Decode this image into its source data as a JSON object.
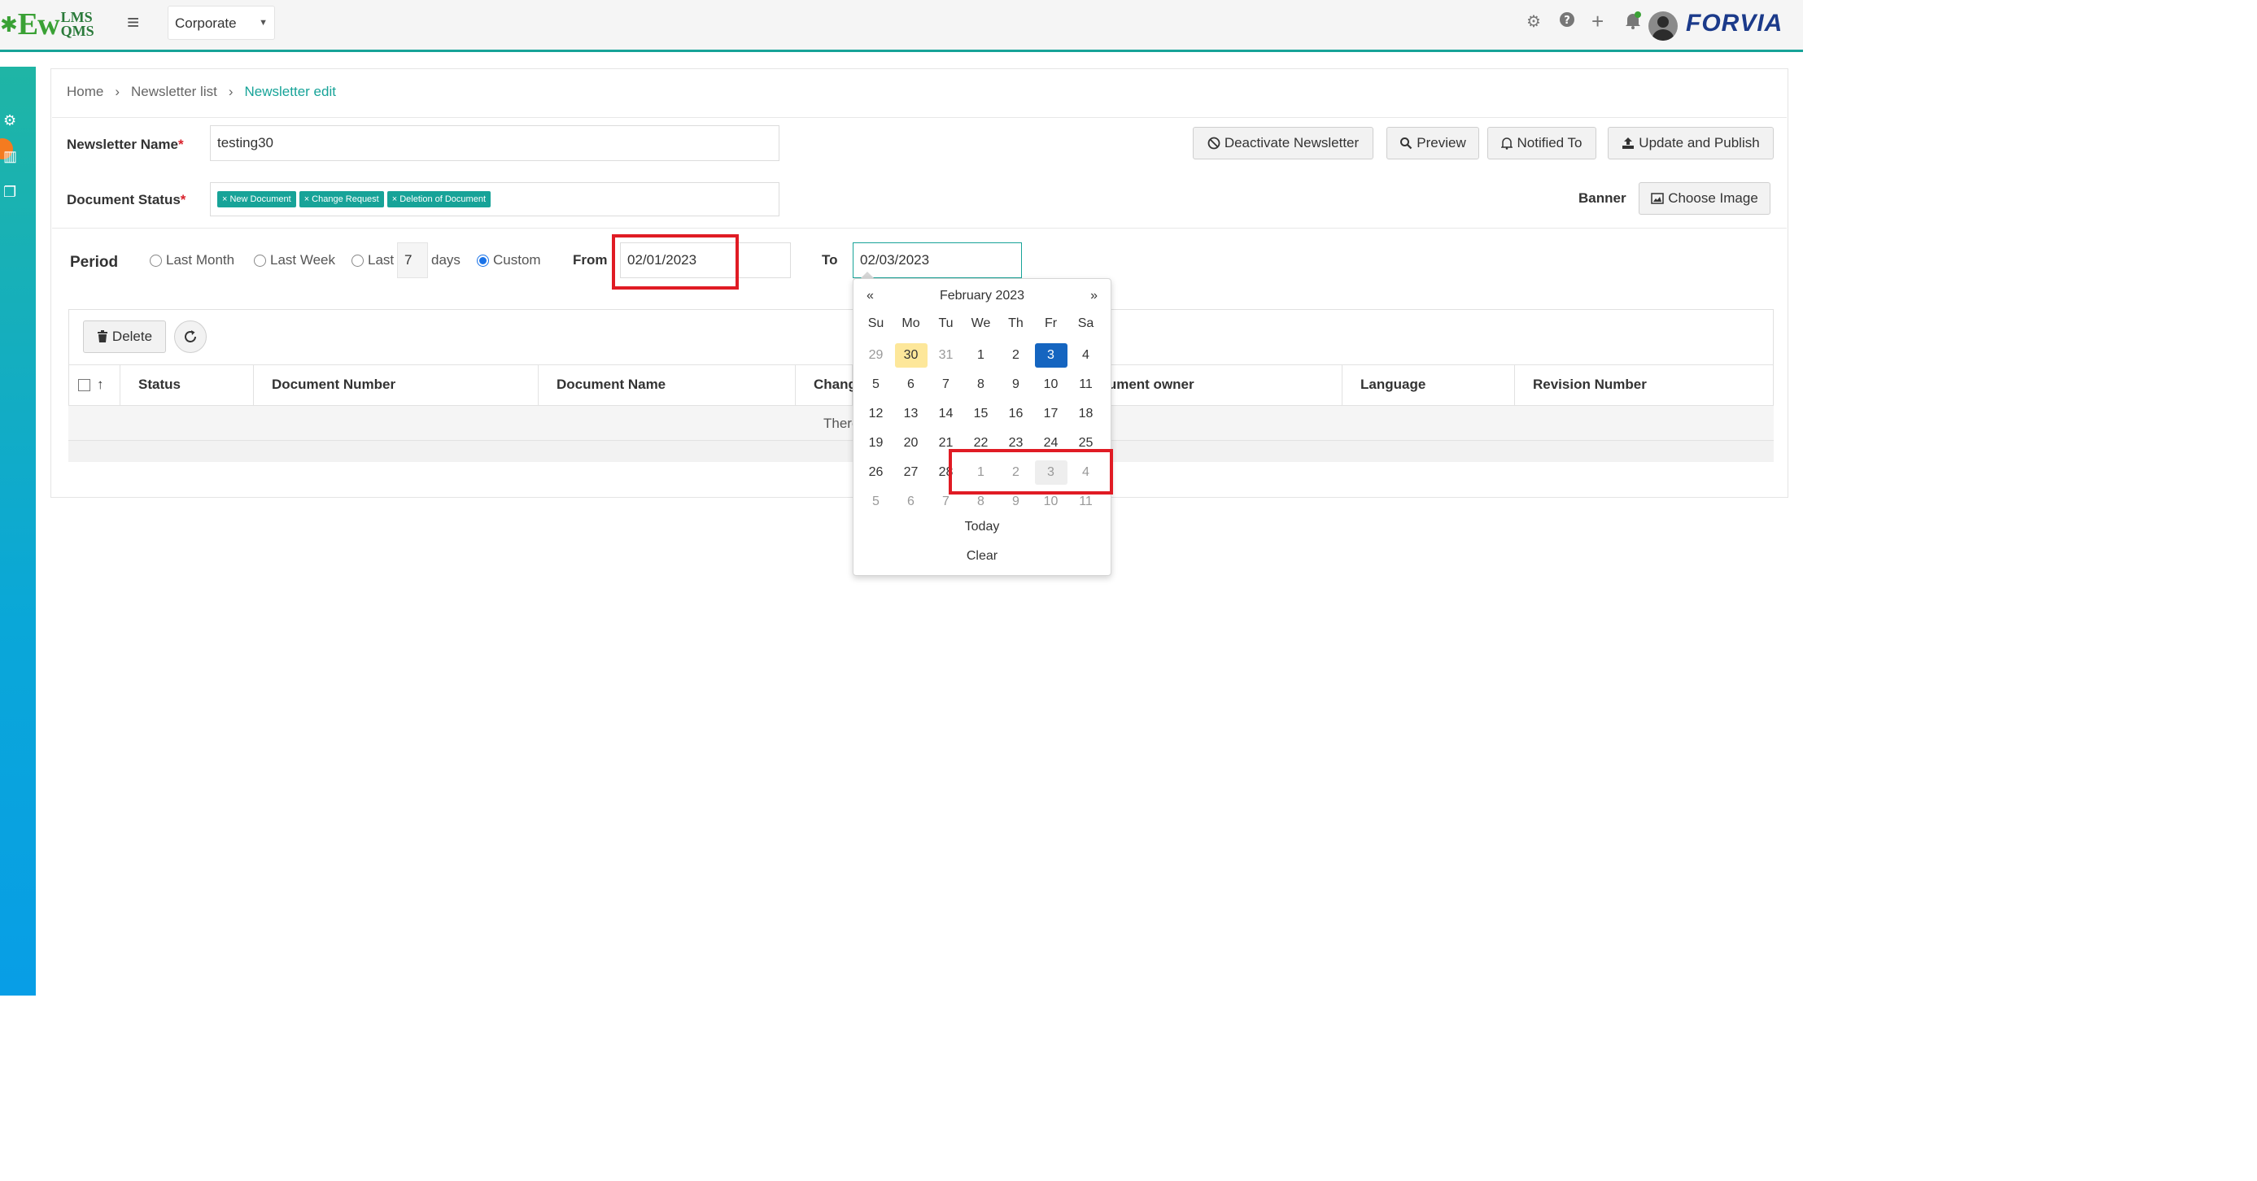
{
  "app": {
    "logo_main": "Ew",
    "logo_sub_top": "LMS",
    "logo_sub_bottom": "QMS",
    "brand": "FORVIA",
    "corporate_select": "Corporate"
  },
  "breadcrumb": {
    "home": "Home",
    "list": "Newsletter list",
    "edit": "Newsletter edit"
  },
  "form": {
    "newsletter_name_label": "Newsletter Name",
    "newsletter_name_value": "testing30",
    "document_status_label": "Document Status",
    "status_tags": [
      "New Document",
      "Change Request",
      "Deletion of Document"
    ],
    "banner_label": "Banner",
    "required_mark": "*"
  },
  "buttons": {
    "deactivate": "Deactivate Newsletter",
    "preview": "Preview",
    "notified_to": "Notified To",
    "update_publish": "Update and Publish",
    "choose_image": "Choose Image",
    "delete": "Delete"
  },
  "period": {
    "label": "Period",
    "last_month": "Last Month",
    "last_week": "Last Week",
    "last": "Last",
    "days_value": "7",
    "days": "days",
    "custom": "Custom",
    "from_label": "From",
    "from_value": "02/01/2023",
    "to_label": "To",
    "to_value": "02/03/2023"
  },
  "table": {
    "headers": [
      "Status",
      "Document Number",
      "Document Name",
      "Chang",
      "ocument owner",
      "Language",
      "Revision Number"
    ],
    "no_records_text": "There"
  },
  "datepicker": {
    "prev": "«",
    "next": "»",
    "month_title": "February 2023",
    "days_of_week": [
      "Su",
      "Mo",
      "Tu",
      "We",
      "Th",
      "Fr",
      "Sa"
    ],
    "weeks": [
      [
        "29",
        "30",
        "31",
        "1",
        "2",
        "3",
        "4"
      ],
      [
        "5",
        "6",
        "7",
        "8",
        "9",
        "10",
        "11"
      ],
      [
        "12",
        "13",
        "14",
        "15",
        "16",
        "17",
        "18"
      ],
      [
        "19",
        "20",
        "21",
        "22",
        "23",
        "24",
        "25"
      ],
      [
        "26",
        "27",
        "28",
        "1",
        "2",
        "3",
        "4"
      ],
      [
        "5",
        "6",
        "7",
        "8",
        "9",
        "10",
        "11"
      ]
    ],
    "today_label": "Today",
    "clear_label": "Clear"
  },
  "colors": {
    "accent": "#17a398",
    "selected_day": "#1565c0",
    "today_highlight": "#fde79a",
    "annotation_red": "#e01b24",
    "brand_blue": "#1b3a8a"
  }
}
